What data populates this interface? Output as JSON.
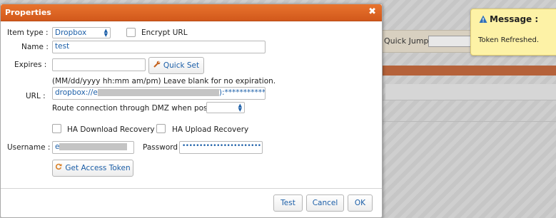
{
  "background": {
    "quick_jump_label": "Quick Jump :"
  },
  "toast": {
    "title": "Message :",
    "body": "Token Refreshed."
  },
  "dialog": {
    "title": "Properties",
    "close_glyph": "✖",
    "item_type": {
      "label": "Item type :",
      "value": "Dropbox"
    },
    "encrypt_url": {
      "label": "Encrypt URL",
      "checked": false
    },
    "name": {
      "label": "Name :",
      "value": "test"
    },
    "expires": {
      "label": "Expires :",
      "value": "",
      "quick_set_label": "Quick Set",
      "hint": "(MM/dd/yyyy hh:mm am/pm) Leave blank for no expiration."
    },
    "url": {
      "label": "URL :",
      "prefix": "dropbox://e",
      "suffix": "):****************"
    },
    "route_dmz": {
      "label": "Route connection through DMZ when possible :",
      "value": ""
    },
    "ha_download": {
      "label": "HA Download Recovery",
      "checked": false
    },
    "ha_upload": {
      "label": "HA Upload Recovery",
      "checked": false
    },
    "username": {
      "label": "Username :",
      "value": "e"
    },
    "password": {
      "label": "Password :",
      "value": "••••••••••••••••••••••••"
    },
    "get_token_label": "Get Access Token",
    "buttons": {
      "test": "Test",
      "cancel": "Cancel",
      "ok": "OK"
    }
  },
  "colors": {
    "titlebar": "#d2581b",
    "link_text": "#1c5fa8",
    "toast_bg": "#fdf2a6"
  },
  "icons": {
    "quick_set": "wrench-icon",
    "get_token": "refresh-icon",
    "toast": "warning-icon"
  }
}
